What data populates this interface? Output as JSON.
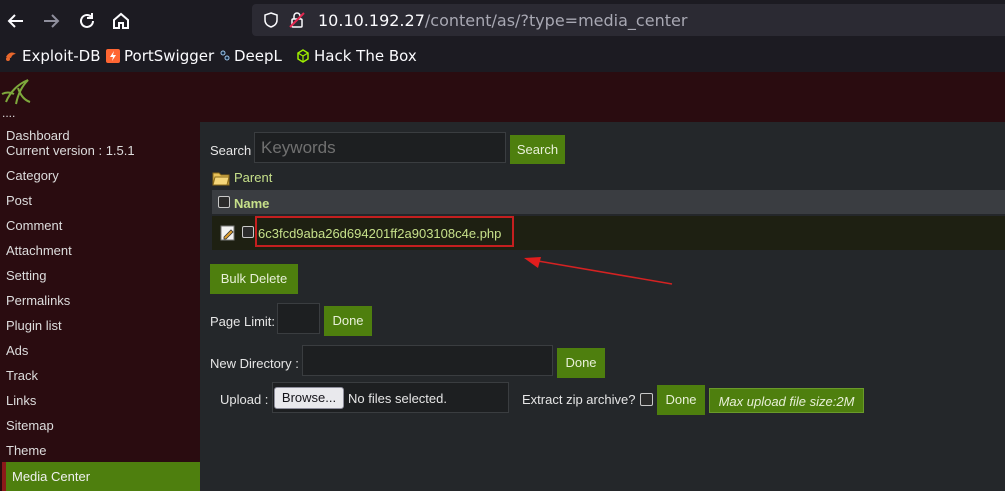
{
  "browser": {
    "url_host": "10.10.192.27",
    "url_path": "/content/as/?type=media_center",
    "bookmarks": [
      {
        "label": "Exploit-DB",
        "icon": "exploitdb-icon"
      },
      {
        "label": "PortSwigger",
        "icon": "portswigger-icon"
      },
      {
        "label": "DeepL",
        "icon": "deepl-icon"
      },
      {
        "label": "Hack The Box",
        "icon": "hackthebox-icon"
      }
    ]
  },
  "sidebar": {
    "logo_dots": "....",
    "dashboard": "Dashboard",
    "version": "Current version : 1.5.1",
    "items": [
      "Category",
      "Post",
      "Comment",
      "Attachment",
      "Setting",
      "Permalinks",
      "Plugin list",
      "Ads",
      "Track",
      "Links",
      "Sitemap",
      "Theme"
    ],
    "active": "Media Center"
  },
  "main": {
    "search_label": "Search",
    "search_placeholder": "Keywords",
    "search_button": "Search",
    "parent_link": "Parent",
    "name_header": "Name",
    "file_name": "6c3fcd9aba26d694201ff2a903108c4e.php",
    "bulk_delete": "Bulk Delete",
    "page_limit_label": "Page Limit:",
    "page_limit_done": "Done",
    "new_dir_label": "New Directory :",
    "new_dir_done": "Done",
    "upload_label": "Upload :",
    "browse_button": "Browse...",
    "no_files": "No files selected.",
    "extract_label": "Extract zip archive?",
    "upload_done": "Done",
    "max_upload": "Max upload file size:2M"
  },
  "colors": {
    "accent_green": "#4e7f0e",
    "highlight_red": "#c41f1f",
    "sidebar_bg": "#2a0c10"
  }
}
